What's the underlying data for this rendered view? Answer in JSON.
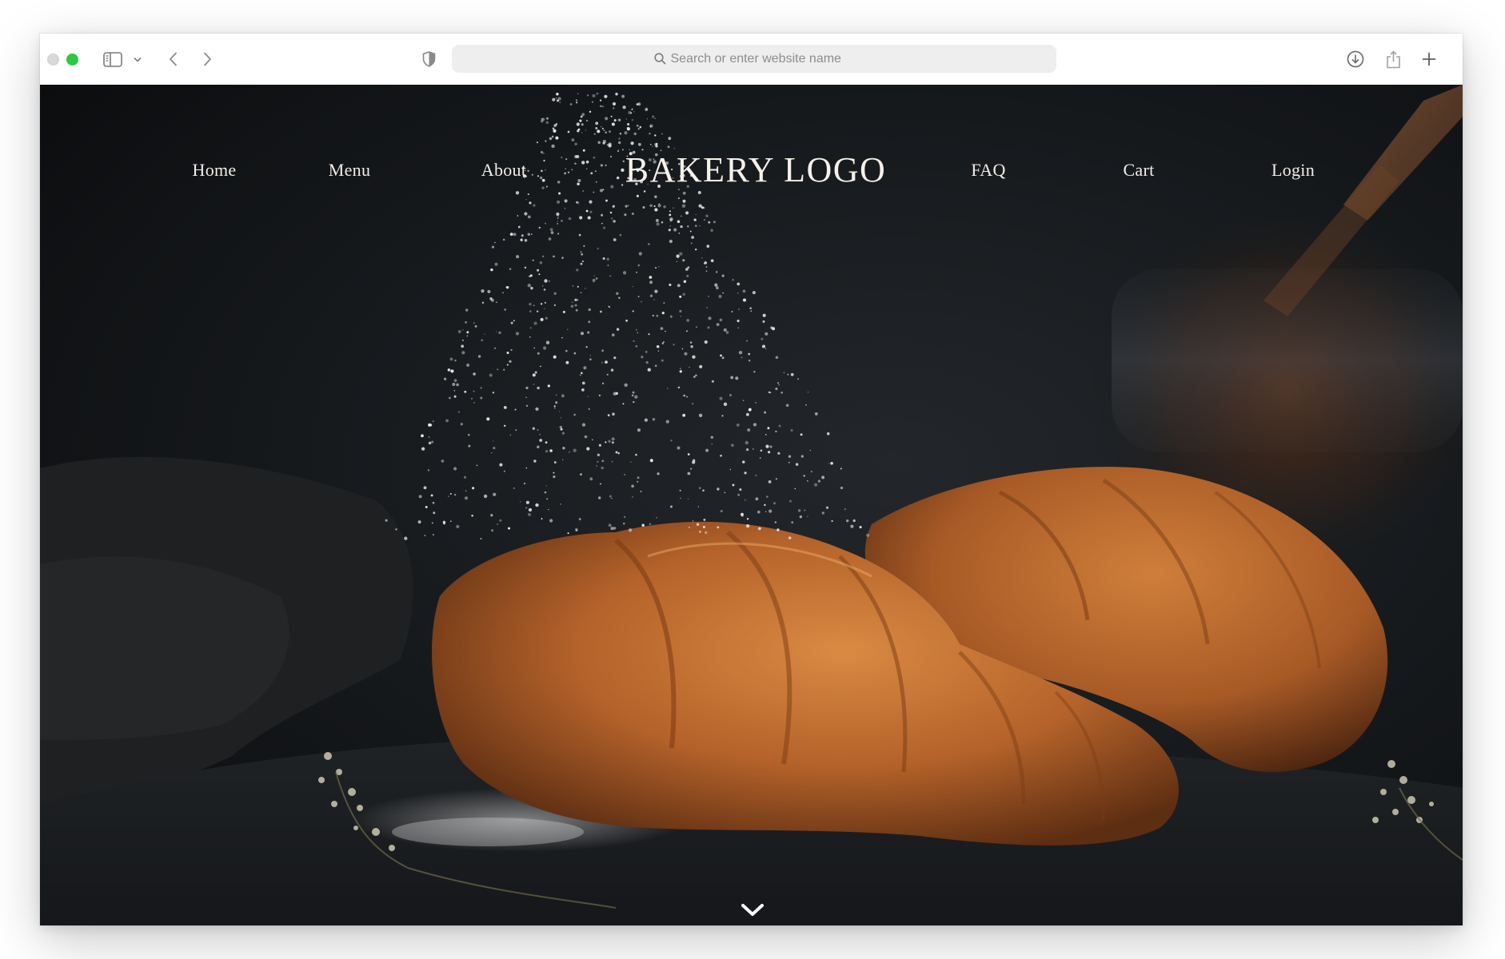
{
  "browser": {
    "address_bar": {
      "placeholder": "Search or enter website name"
    },
    "icons": {
      "sidebar": "sidebar-icon",
      "sidebar_menu": "chevron-down-icon",
      "back": "chevron-left-icon",
      "forward": "chevron-right-icon",
      "privacy": "shield-icon",
      "search": "search-icon",
      "downloads": "download-icon",
      "share": "share-icon",
      "new_tab": "plus-icon"
    }
  },
  "site": {
    "logo": "BAKERY LOGO",
    "nav_left": [
      "Home",
      "Menu",
      "About"
    ],
    "nav_right": [
      "FAQ",
      "Cart",
      "Login"
    ],
    "scroll_icon": "chevron-down-icon"
  },
  "colors": {
    "nav_text": "#f2ede6",
    "hero_background": "#141618",
    "pastry": "#b8652a",
    "traffic_green": "#2bc840"
  }
}
